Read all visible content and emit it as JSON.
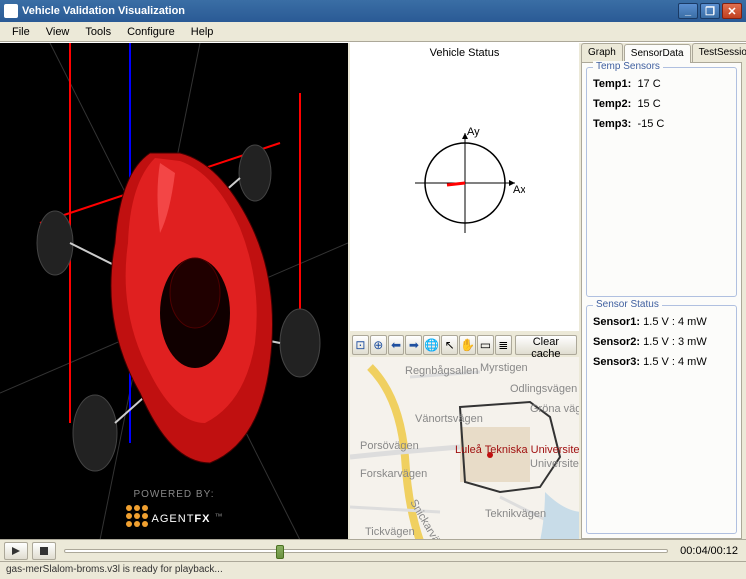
{
  "window": {
    "title": "Vehicle Validation Visualization"
  },
  "menu": {
    "file": "File",
    "view": "View",
    "tools": "Tools",
    "configure": "Configure",
    "help": "Help"
  },
  "branding": {
    "powered_by": "POWERED BY:",
    "logo_main": "AGENT",
    "logo_bold": "FX",
    "tm": "™"
  },
  "vehicle_status": {
    "title": "Vehicle Status",
    "axis_y": "Ay",
    "axis_x": "Ax"
  },
  "map_toolbar": {
    "clear_cache": "Clear cache"
  },
  "map": {
    "label_main": "Luleå Tekniska Universitet",
    "streets": [
      "Regnbågsallen",
      "Myrstigen",
      "Odlingsvägen",
      "Gröna vägen",
      "Universitetsvägen",
      "Porsövägen",
      "Vänortsvägen",
      "Forskarvägen",
      "Snickarvägen",
      "Tickvägen",
      "Teknikvägen"
    ]
  },
  "tabs": {
    "graph": "Graph",
    "sensordata": "SensorData",
    "testsession": "TestSession"
  },
  "temp_sensors": {
    "legend": "Temp Sensors",
    "rows": [
      {
        "label": "Temp1:",
        "value": "17  C"
      },
      {
        "label": "Temp2:",
        "value": "15  C"
      },
      {
        "label": "Temp3:",
        "value": "-15  C"
      }
    ]
  },
  "sensor_status": {
    "legend": "Sensor Status",
    "rows": [
      {
        "label": "Sensor1:",
        "value": "1.5 V :  4   mW"
      },
      {
        "label": "Sensor2:",
        "value": "1.5 V :  3   mW"
      },
      {
        "label": "Sensor3:",
        "value": "1.5 V :  4   mW"
      }
    ]
  },
  "playback": {
    "elapsed": "00:04",
    "total": "00:12"
  },
  "statusbar": {
    "text": "gas-merSlalom-broms.v3l is ready for playback..."
  }
}
